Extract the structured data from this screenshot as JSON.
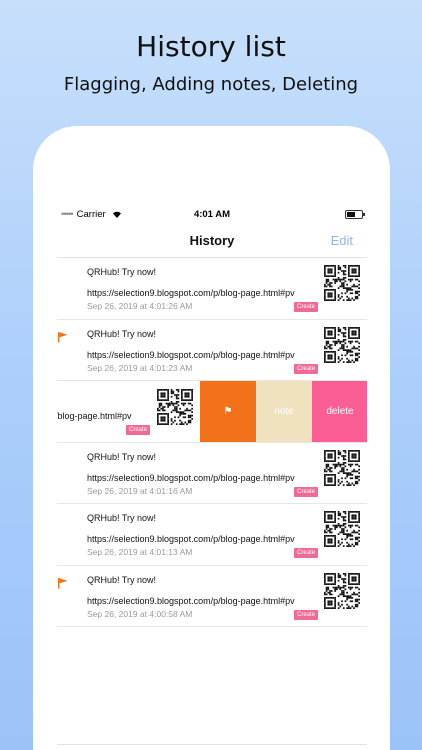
{
  "banner": {
    "title": "History list",
    "subtitle": "Flagging, Adding notes, Deleting"
  },
  "statusbar": {
    "carrier": "Carrier",
    "time": "4:01 AM"
  },
  "navbar": {
    "title": "History",
    "edit_label": "Edit"
  },
  "history": [
    {
      "title": "QRHub! Try now!",
      "url": "https://selection9.blogspot.com/p/blog-page.html#pv",
      "date": "Sep 26, 2019 at 4:01:26 AM",
      "badge": "Create",
      "flagged": false
    },
    {
      "title": "QRHub! Try now!",
      "url": "https://selection9.blogspot.com/p/blog-page.html#pv",
      "date": "Sep 26, 2019 at 4:01:23 AM",
      "badge": "Create",
      "flagged": true
    },
    {
      "url_fragment": "/blog-page.html#pv",
      "badge": "Create",
      "swiped": true
    },
    {
      "title": "QRHub! Try now!",
      "url": "https://selection9.blogspot.com/p/blog-page.html#pv",
      "date": "Sep 26, 2019 at 4:01:16 AM",
      "badge": "Create",
      "flagged": false
    },
    {
      "title": "QRHub! Try now!",
      "url": "https://selection9.blogspot.com/p/blog-page.html#pv",
      "date": "Sep 26, 2019 at 4:01:13 AM",
      "badge": "Create",
      "flagged": false
    },
    {
      "title": "QRHub! Try now!",
      "url": "https://selection9.blogspot.com/p/blog-page.html#pv",
      "date": "Sep 26, 2019 at 4:00:58 AM",
      "badge": "Create",
      "flagged": true
    }
  ],
  "swipe_actions": {
    "flag_icon": "⚑",
    "note_label": "note",
    "delete_label": "delete"
  },
  "colors": {
    "flag": "#f2721c",
    "note": "#f0e1bf",
    "delete": "#fb5e95",
    "badge": "#ef6a96",
    "edit": "#8fb6e8"
  },
  "tabbar": {
    "icons": [
      "scan-icon",
      "create-qr-icon",
      "history-icon",
      "more-icon"
    ]
  }
}
